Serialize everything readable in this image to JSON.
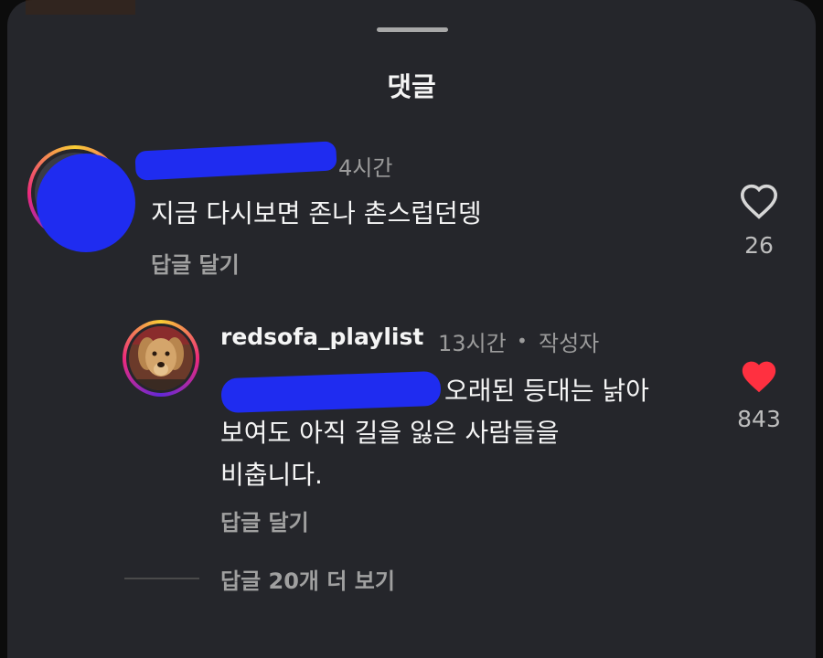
{
  "sheet": {
    "title": "댓글"
  },
  "comments": [
    {
      "time": "4시간",
      "text": "지금 다시보면 존나 촌스럽던뎅",
      "reply_label": "답글 달기",
      "likes": "26",
      "liked": false
    },
    {
      "username": "redsofa_playlist",
      "time": "13시간",
      "separator": "•",
      "author_badge": "작성자",
      "text_lines": [
        "오래된 등대는 낡아",
        "보여도 아직 길을 잃은 사람들을",
        "비춥니다."
      ],
      "reply_label": "답글 달기",
      "likes": "843",
      "liked": true
    }
  ],
  "view_replies": "답글 20개 더 보기",
  "colors": {
    "like": "#ff3040",
    "redaction": "#1f2cf0",
    "sheet": "#25262b"
  },
  "icons": [
    "heart-outline-icon",
    "heart-filled-icon"
  ]
}
